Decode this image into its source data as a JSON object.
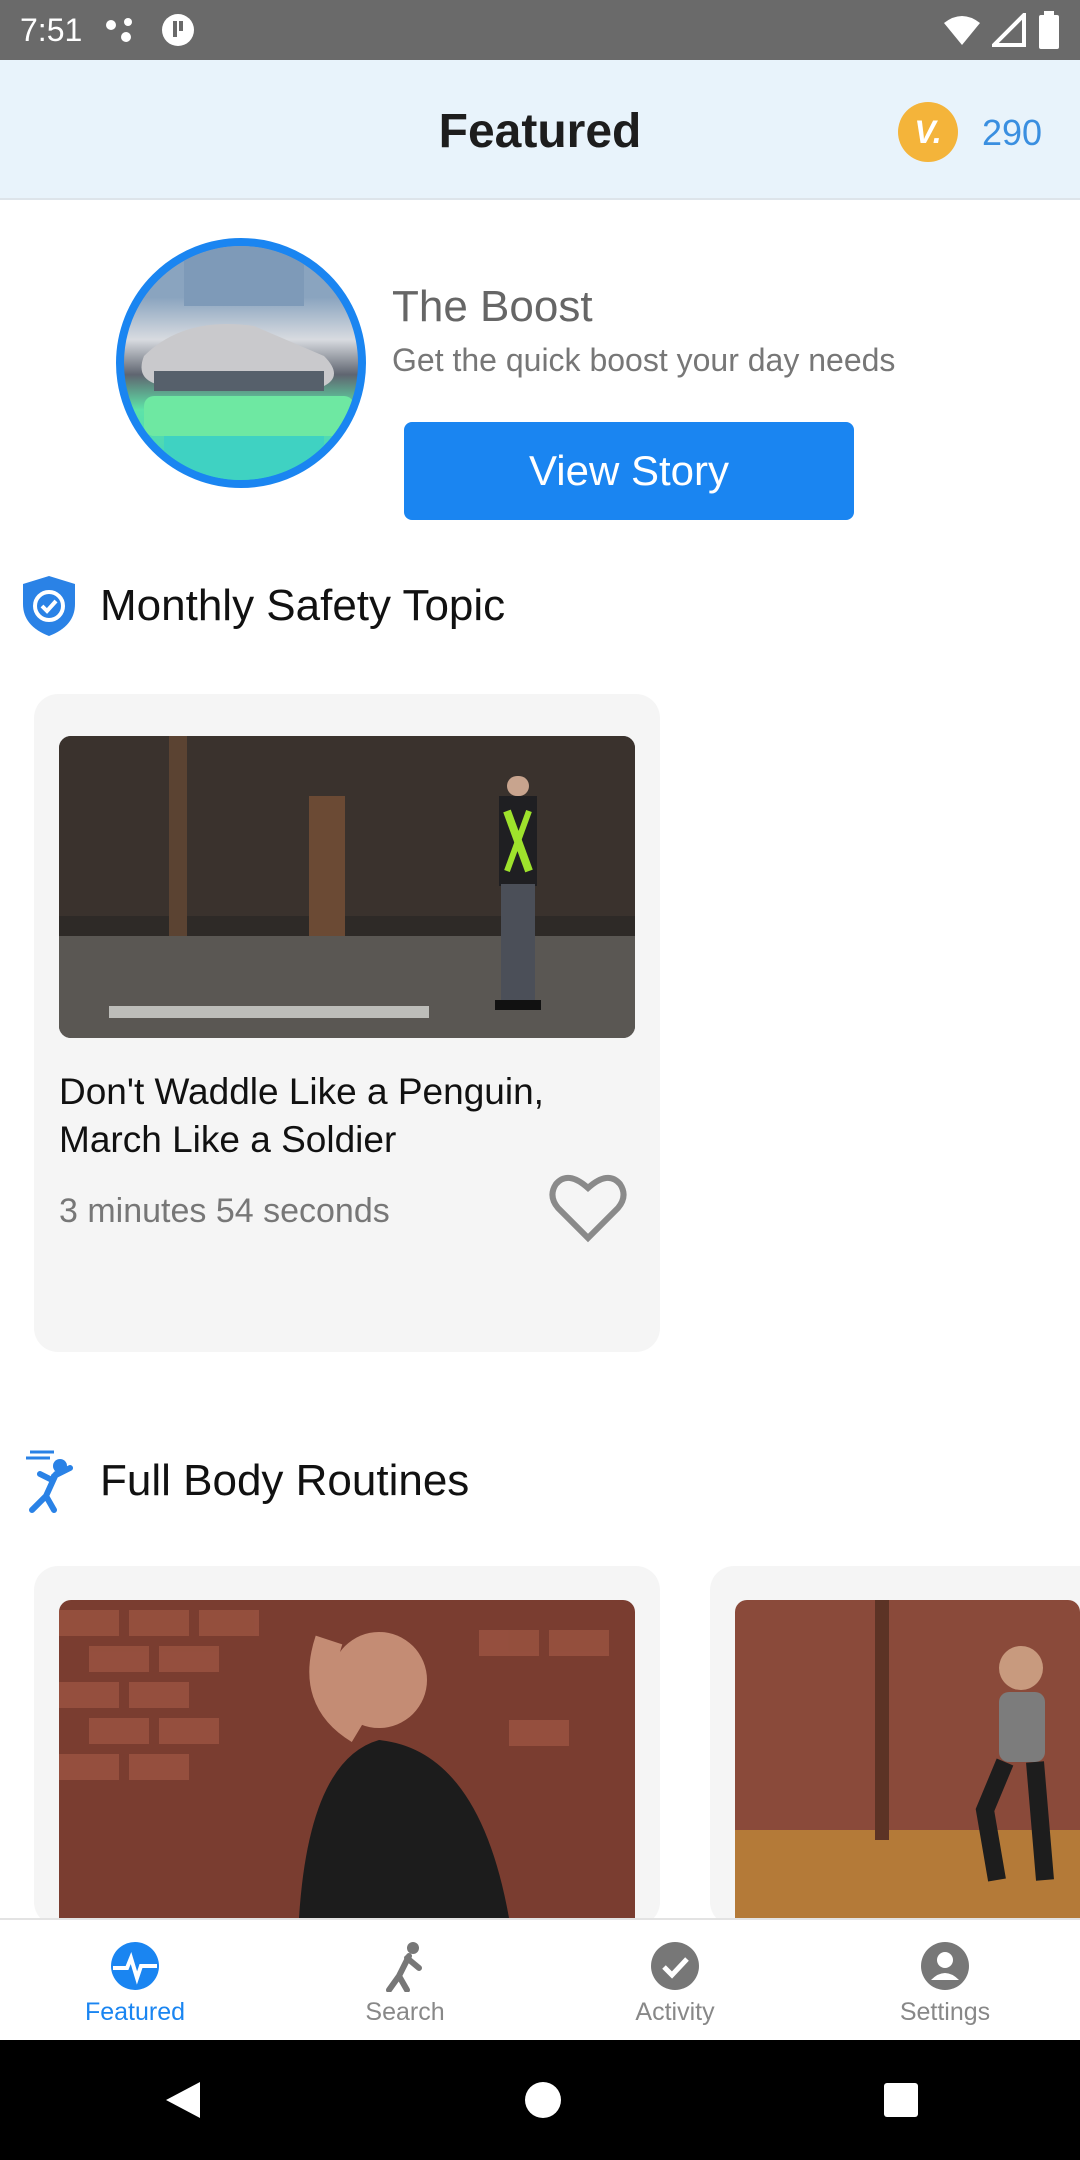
{
  "status_bar": {
    "time": "7:51"
  },
  "header": {
    "title": "Featured",
    "points": "290",
    "coin_letter": "V."
  },
  "boost": {
    "title": "The Boost",
    "subtitle": "Get the quick boost your day needs",
    "button_label": "View Story"
  },
  "safety": {
    "section_title": "Monthly Safety Topic",
    "card": {
      "title": "Don't Waddle Like a Penguin, March Like a Soldier",
      "duration": "3 minutes 54 seconds"
    }
  },
  "routines": {
    "section_title": "Full Body Routines"
  },
  "bottom_nav": {
    "items": [
      {
        "label": "Featured",
        "icon": "heart-pulse-icon",
        "active": true
      },
      {
        "label": "Search",
        "icon": "runner-icon",
        "active": false
      },
      {
        "label": "Activity",
        "icon": "check-circle-icon",
        "active": false
      },
      {
        "label": "Settings",
        "icon": "person-circle-icon",
        "active": false
      }
    ]
  },
  "colors": {
    "accent": "#1a85f1",
    "header_bg": "#e8f3fb",
    "coin": "#f4b43a"
  }
}
